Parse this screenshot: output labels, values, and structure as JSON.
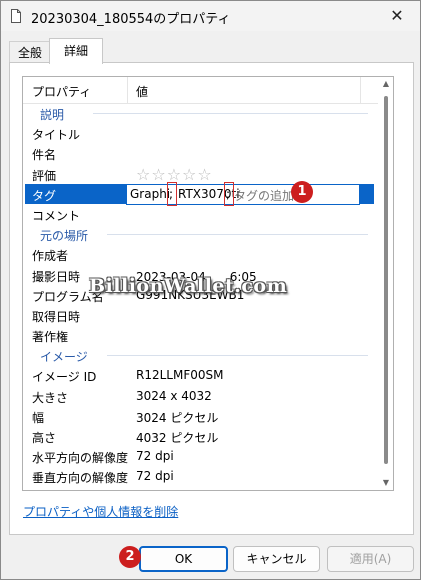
{
  "window": {
    "title": "20230304_180554のプロパティ",
    "close_glyph": "✕"
  },
  "tabs": [
    {
      "label": "全般",
      "active": false
    },
    {
      "label": "詳細",
      "active": true
    }
  ],
  "list": {
    "headers": {
      "property": "プロパティ",
      "value": "値"
    },
    "sections": {
      "description": "説明",
      "origin": "元の場所",
      "image": "イメージ"
    },
    "rows": {
      "title": {
        "key": "タイトル",
        "value": ""
      },
      "subject": {
        "key": "件名",
        "value": ""
      },
      "rating": {
        "key": "評価",
        "stars": "☆☆☆☆☆",
        "value": 0,
        "max": 5
      },
      "tags": {
        "key": "タグ",
        "part1": "Graphi",
        "sep1": ";",
        "part2": "RTX3070ti",
        "sep2": ";",
        "placeholder": "タグの追加"
      },
      "comments": {
        "key": "コメント",
        "value": ""
      },
      "authors": {
        "key": "作成者",
        "value": ""
      },
      "date_taken": {
        "key": "撮影日時",
        "value": "2023-03-04　　6:05"
      },
      "program": {
        "key": "プログラム名",
        "value": "G991NKSU3EWB1"
      },
      "date_acquired": {
        "key": "取得日時",
        "value": ""
      },
      "copyright": {
        "key": "著作権",
        "value": ""
      },
      "image_id": {
        "key": "イメージ ID",
        "value": "R12LLMF00SM"
      },
      "dimensions": {
        "key": "大きさ",
        "value": "3024 x 4032"
      },
      "width": {
        "key": "幅",
        "value": "3024 ピクセル"
      },
      "height": {
        "key": "高さ",
        "value": "4032 ピクセル"
      },
      "hres": {
        "key": "水平方向の解像度",
        "value": "72 dpi"
      },
      "vres": {
        "key": "垂直方向の解像度",
        "value": "72 dpi"
      }
    }
  },
  "remove_link": "プロパティや個人情報を削除",
  "buttons": {
    "ok": "OK",
    "cancel": "キャンセル",
    "apply": "適用(A)"
  },
  "annotations": {
    "badge1": "1",
    "badge2": "2"
  },
  "watermark": "BillionWallet.com",
  "colors": {
    "accent": "#0a64c8",
    "badge": "#cc1e1e",
    "link": "#0a5fc4"
  }
}
